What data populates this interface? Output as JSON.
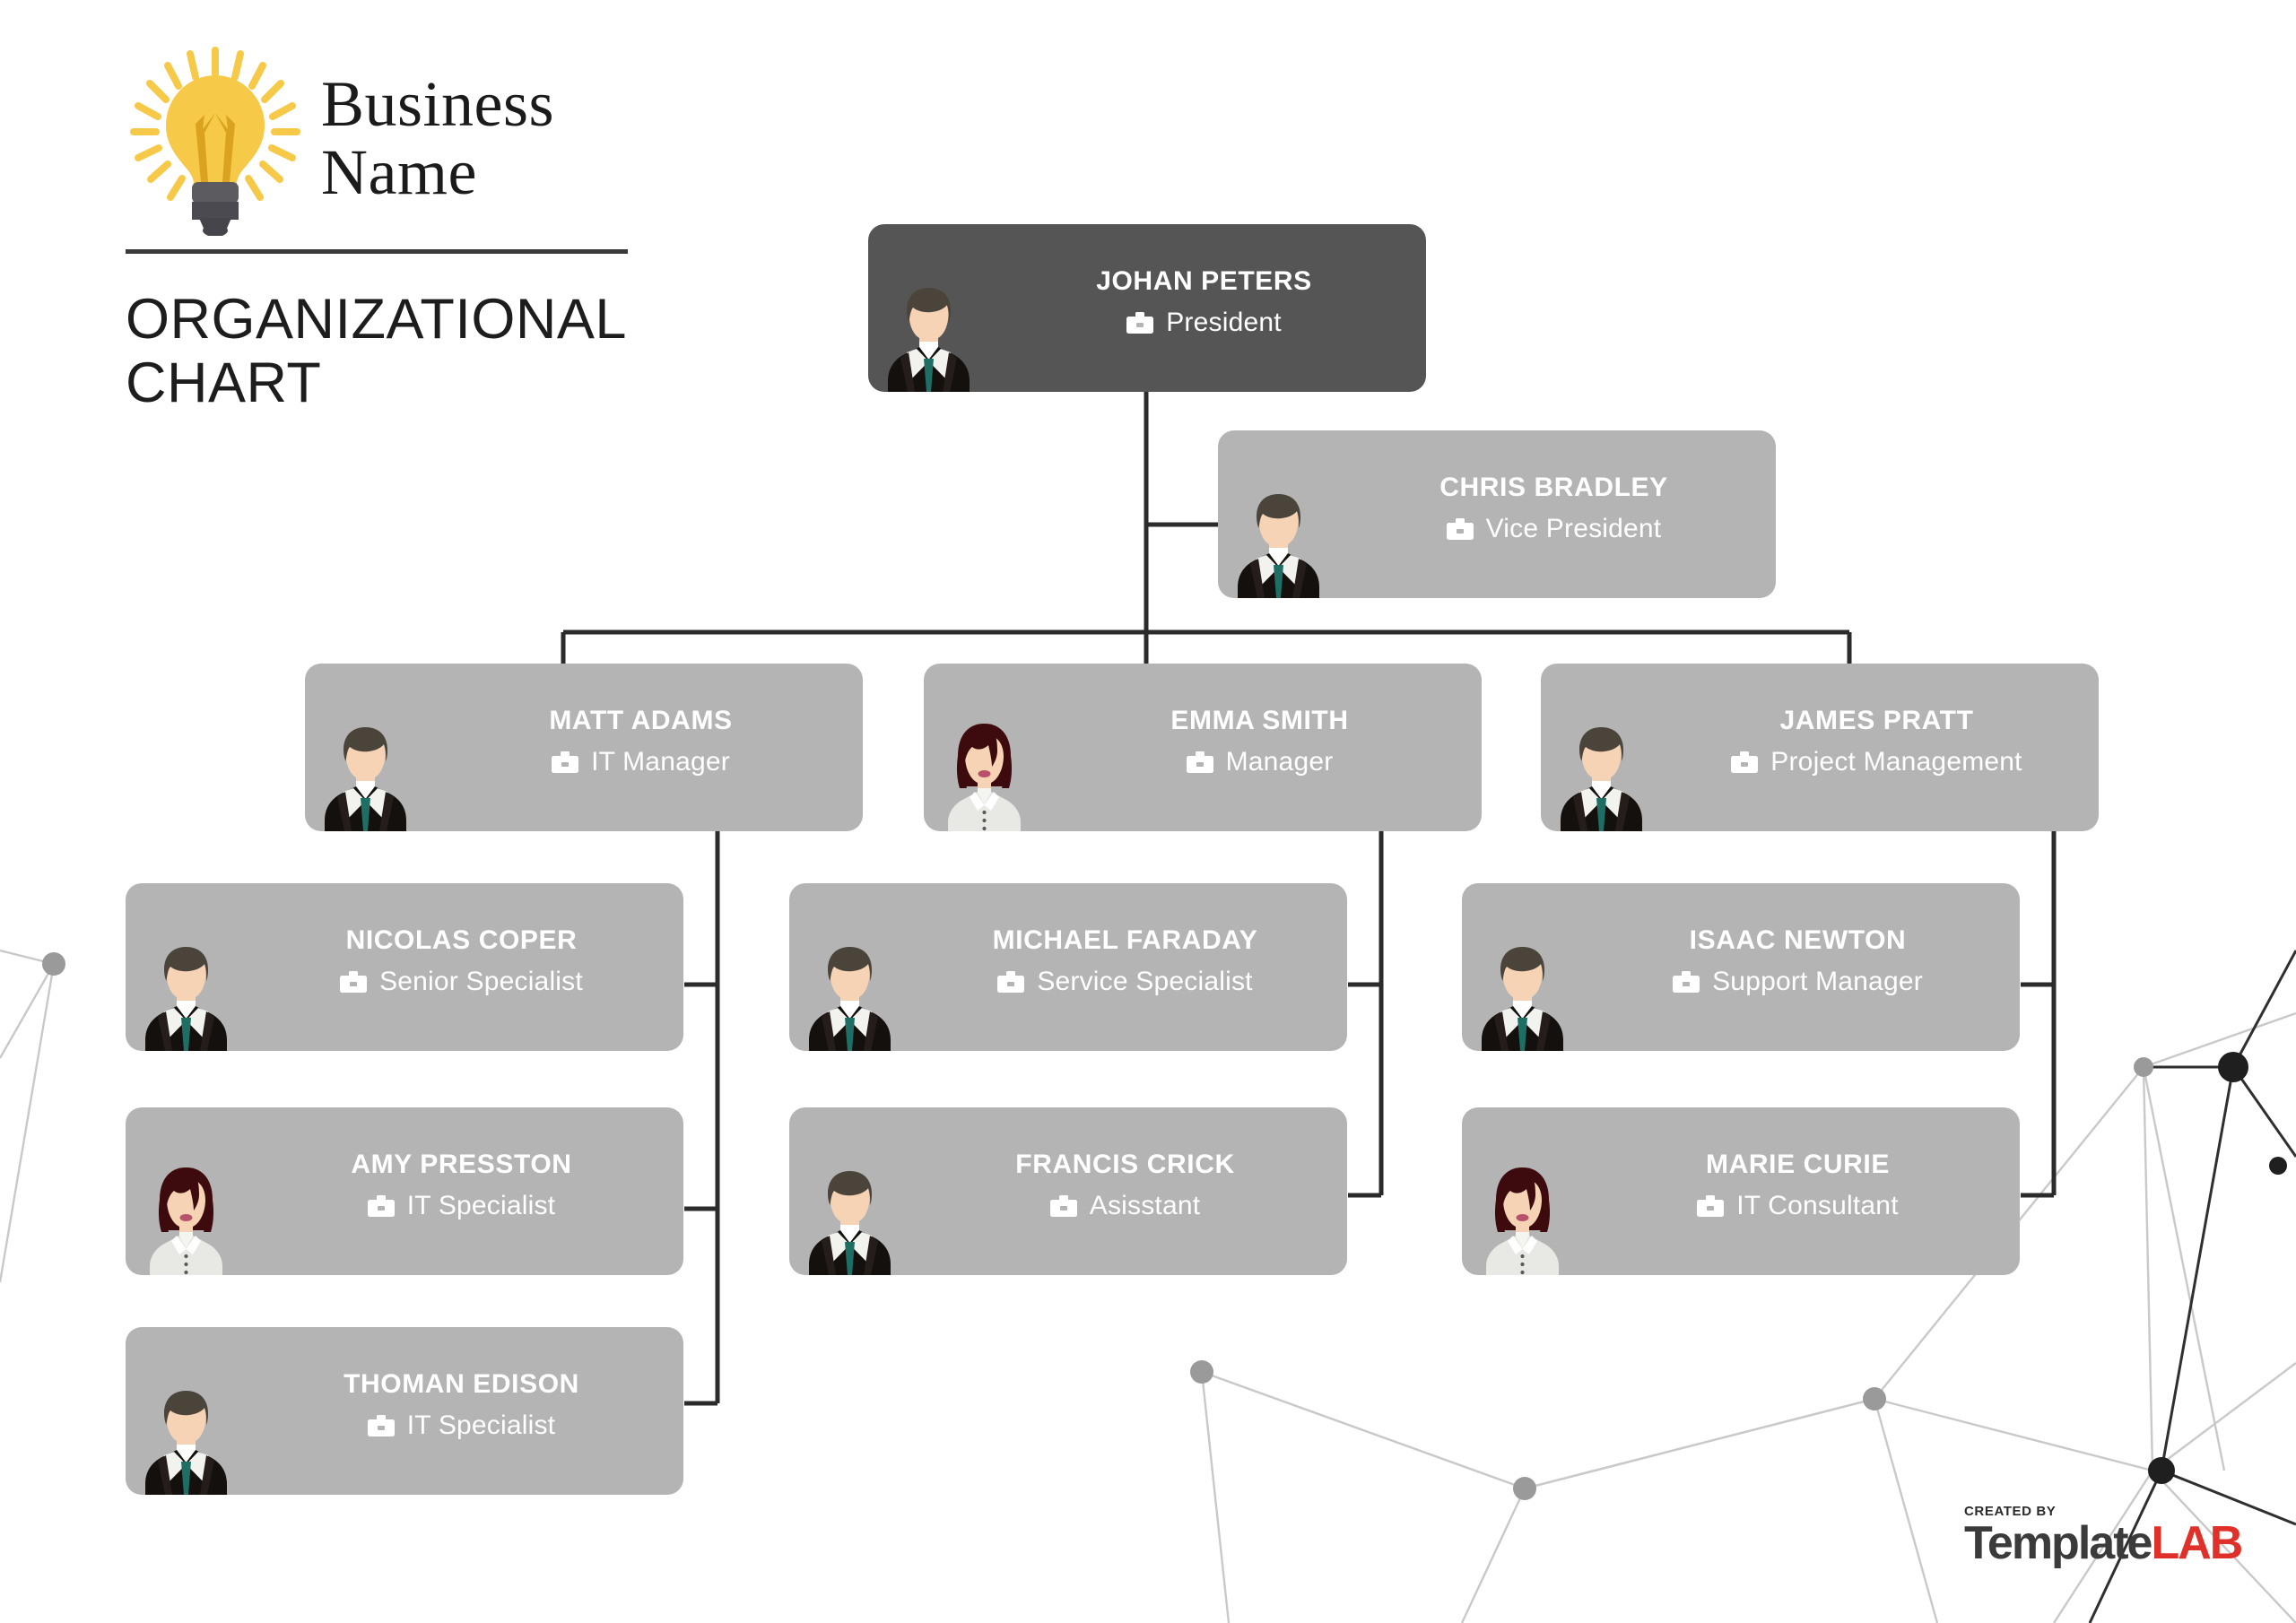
{
  "header": {
    "brand_line1": "Business",
    "brand_line2": "Name",
    "title_line1": "ORGANIZATIONAL",
    "title_line2": "CHART",
    "logo_icon": "lightbulb-icon"
  },
  "footer": {
    "created_by": "CREATED BY",
    "brand_template": "Template",
    "brand_lab": "LAB"
  },
  "colors": {
    "card_default": "#b4b4b4",
    "card_root": "#555555",
    "card_text": "#ffffff",
    "connector": "#2b2b2b",
    "accent_tie": "#1e6e64",
    "bulb_yellow": "#f7c948",
    "lab_red": "#e0302a",
    "page_background": "#ffffff"
  },
  "chart_data": {
    "type": "org-chart",
    "title": "ORGANIZATIONAL CHART",
    "role_icon": "briefcase-icon",
    "nodes": [
      {
        "id": "johan",
        "name": "JOHAN PETERS",
        "role": "President",
        "avatar": "male",
        "level": 0,
        "parent": null,
        "style": "root"
      },
      {
        "id": "chris",
        "name": "CHRIS BRADLEY",
        "role": "Vice President",
        "avatar": "male",
        "level": 1,
        "parent": "johan",
        "style": "default"
      },
      {
        "id": "matt",
        "name": "MATT ADAMS",
        "role": "IT Manager",
        "avatar": "male",
        "level": 2,
        "parent": "johan",
        "style": "default"
      },
      {
        "id": "emma",
        "name": "EMMA SMITH",
        "role": "Manager",
        "avatar": "female",
        "level": 2,
        "parent": "johan",
        "style": "default"
      },
      {
        "id": "james",
        "name": "JAMES PRATT",
        "role": "Project Management",
        "avatar": "male",
        "level": 2,
        "parent": "johan",
        "style": "default"
      },
      {
        "id": "nicolas",
        "name": "NICOLAS COPER",
        "role": "Senior Specialist",
        "avatar": "male",
        "level": 3,
        "parent": "matt",
        "style": "default"
      },
      {
        "id": "amy",
        "name": "AMY PRESSTON",
        "role": "IT Specialist",
        "avatar": "female",
        "level": 3,
        "parent": "matt",
        "style": "default"
      },
      {
        "id": "thoman",
        "name": "THOMAN EDISON",
        "role": "IT Specialist",
        "avatar": "male",
        "level": 3,
        "parent": "matt",
        "style": "default"
      },
      {
        "id": "michael",
        "name": "MICHAEL FARADAY",
        "role": "Service Specialist",
        "avatar": "male",
        "level": 3,
        "parent": "emma",
        "style": "default"
      },
      {
        "id": "francis",
        "name": "FRANCIS CRICK",
        "role": "Asisstant",
        "avatar": "male",
        "level": 3,
        "parent": "emma",
        "style": "default"
      },
      {
        "id": "isaac",
        "name": "ISAAC NEWTON",
        "role": "Support Manager",
        "avatar": "male",
        "level": 3,
        "parent": "james",
        "style": "default"
      },
      {
        "id": "marie",
        "name": "MARIE CURIE",
        "role": "IT Consultant",
        "avatar": "female",
        "level": 3,
        "parent": "james",
        "style": "default"
      }
    ]
  },
  "nodes": {
    "johan": {
      "name": "JOHAN PETERS",
      "role": "President"
    },
    "chris": {
      "name": "CHRIS BRADLEY",
      "role": "Vice President"
    },
    "matt": {
      "name": "MATT ADAMS",
      "role": "IT Manager"
    },
    "emma": {
      "name": "EMMA SMITH",
      "role": "Manager"
    },
    "james": {
      "name": "JAMES PRATT",
      "role": "Project Management"
    },
    "nicolas": {
      "name": "NICOLAS COPER",
      "role": "Senior Specialist"
    },
    "amy": {
      "name": "AMY PRESSTON",
      "role": "IT Specialist"
    },
    "thoman": {
      "name": "THOMAN EDISON",
      "role": "IT Specialist"
    },
    "michael": {
      "name": "MICHAEL FARADAY",
      "role": "Service Specialist"
    },
    "francis": {
      "name": "FRANCIS CRICK",
      "role": "Asisstant"
    },
    "isaac": {
      "name": "ISAAC NEWTON",
      "role": "Support Manager"
    },
    "marie": {
      "name": "MARIE CURIE",
      "role": "IT Consultant"
    }
  }
}
